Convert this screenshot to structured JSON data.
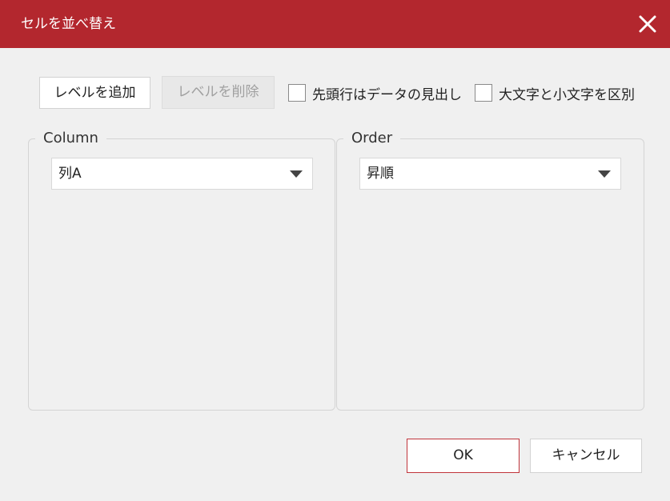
{
  "dialog": {
    "title": "セルを並べ替え",
    "close_icon": "close-icon"
  },
  "toolbar": {
    "add_level_label": "レベルを追加",
    "delete_level_label": "レベルを削除",
    "header_checkbox_label": "先頭行はデータの見出し",
    "header_checkbox_checked": false,
    "case_checkbox_label": "大文字と小文字を区別",
    "case_checkbox_checked": false
  },
  "column_group": {
    "legend": "Column",
    "selected": "列A"
  },
  "order_group": {
    "legend": "Order",
    "selected": "昇順"
  },
  "footer": {
    "ok_label": "OK",
    "cancel_label": "キャンセル"
  },
  "colors": {
    "titlebar": "#b3272e",
    "background": "#f0f0f0",
    "ok_border": "#c0343b"
  }
}
